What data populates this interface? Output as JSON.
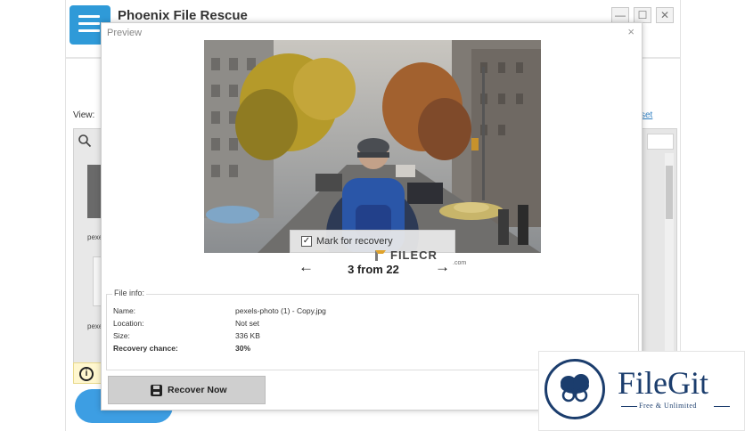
{
  "app": {
    "title": "Phoenix File Rescue",
    "controls": {
      "minimize": "—",
      "maximize": "☐",
      "close": "✕"
    },
    "view_label": "View:",
    "reset_link": "set",
    "left_truncated_1": "pexe",
    "left_truncated_2": "pexe",
    "info_icon": "i",
    "accent_color": "#2f9ad8"
  },
  "dialog": {
    "title": "Preview",
    "close": "×",
    "mark_for_recovery": {
      "label": "Mark for recovery",
      "checked": true,
      "check_glyph": "✓"
    },
    "nav": {
      "prev": "←",
      "next": "→",
      "count": "3 from 22"
    },
    "file_info": {
      "legend": "File info:",
      "rows": [
        {
          "label": "Name:",
          "value": "pexels-photo (1) - Copy.jpg",
          "bold": false
        },
        {
          "label": "Location:",
          "value": "Not set",
          "bold": false
        },
        {
          "label": "Size:",
          "value": "336 KB",
          "bold": false
        },
        {
          "label": "Recovery chance:",
          "value": "30%",
          "bold": true
        }
      ]
    },
    "recover_button": {
      "label": "Recover Now",
      "icon": "save-icon"
    }
  },
  "watermarks": {
    "filecr": "FILECR",
    "filecr_com": ".com",
    "filegit_name": "FileGit",
    "filegit_tagline": "Free & Unlimited"
  }
}
